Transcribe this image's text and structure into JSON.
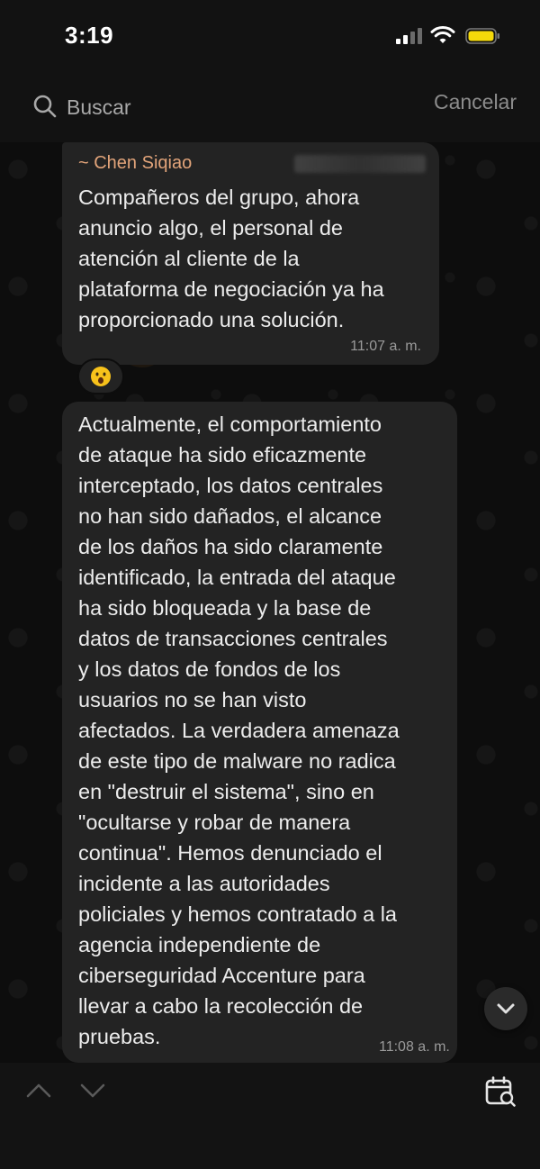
{
  "status_bar": {
    "time": "3:19",
    "battery_color": "#f5d90a",
    "icons": [
      "signal-icon",
      "wifi-icon",
      "battery-icon"
    ]
  },
  "search": {
    "placeholder": "Buscar",
    "cancel_label": "Cancelar"
  },
  "messages": [
    {
      "sender": "~ Chen Siqiao",
      "text": "Compañeros del grupo, ahora\nanuncio algo, el personal de\natención al cliente de la\nplataforma de negociación ya ha\nproporcionado una solución.",
      "time": "11:07 a. m.",
      "reaction_icon": "astonished-face-emoji"
    },
    {
      "text": "Actualmente, el comportamiento\nde ataque ha sido eficazmente\ninterceptado, los datos centrales\nno han sido dañados, el alcance\nde los daños ha sido claramente\nidentificado, la entrada del ataque\nha sido bloqueada y la base de\ndatos de transacciones centrales\ny los datos de fondos de los\nusuarios no se han visto\nafectados. La verdadera amenaza\nde este tipo de malware no radica\nen \"destruir el sistema\", sino en\n\"ocultarse y robar de manera\ncontinua\". Hemos denunciado el\nincidente a las autoridades\npoliciales y hemos contratado a la\nagencia independiente de\nciberseguridad Accenture para\nllevar a cabo la recolección de\npruebas.",
      "time": "11:08 a. m."
    }
  ],
  "colors": {
    "sender_name": "#e2a47a",
    "bubble": "#232323",
    "background": "#0d0d0d"
  },
  "bottom_bar": {
    "icons": [
      "chevron-up-icon",
      "chevron-down-icon",
      "calendar-search-icon"
    ]
  }
}
